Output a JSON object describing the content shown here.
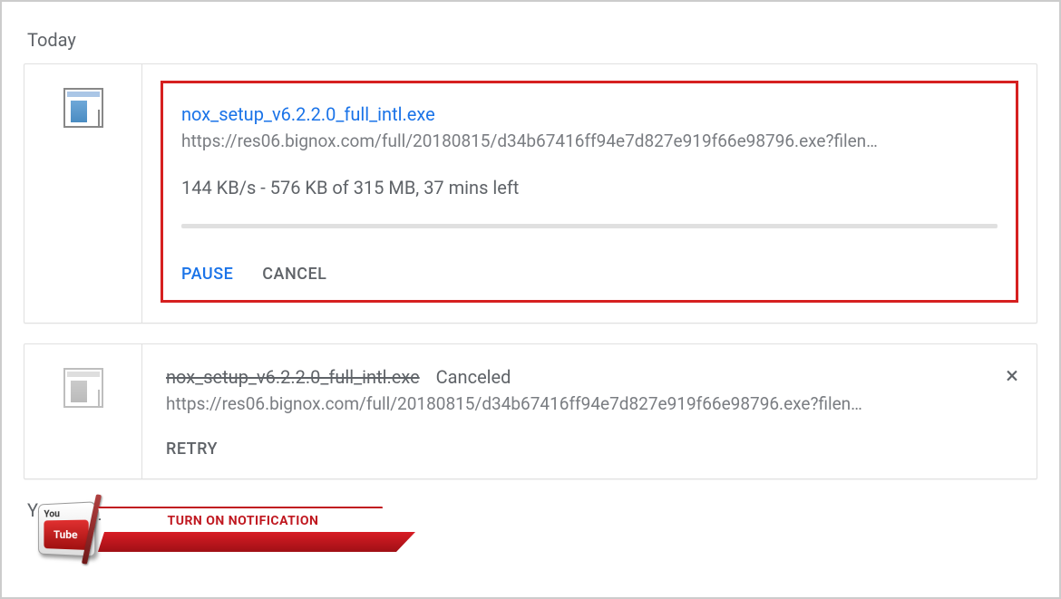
{
  "sections": {
    "today": "Today",
    "yesterday": "Yesterday"
  },
  "download1": {
    "filename": "nox_setup_v6.2.2.0_full_intl.exe",
    "url": "https://res06.bignox.com/full/20180815/d34b67416ff94e7d827e919f66e98796.exe?filen…",
    "progress": "144 KB/s - 576 KB of 315 MB, 37 mins left",
    "pause": "PAUSE",
    "cancel": "CANCEL"
  },
  "download2": {
    "filename": "nox_setup_v6.2.2.0_full_intl.exe",
    "status": "Canceled",
    "url": "https://res06.bignox.com/full/20180815/d34b67416ff94e7d827e919f66e98796.exe?filen…",
    "retry": "RETRY"
  },
  "banner": {
    "you": "You",
    "tube": "Tube",
    "text": "TURN ON NOTIFICATION"
  }
}
